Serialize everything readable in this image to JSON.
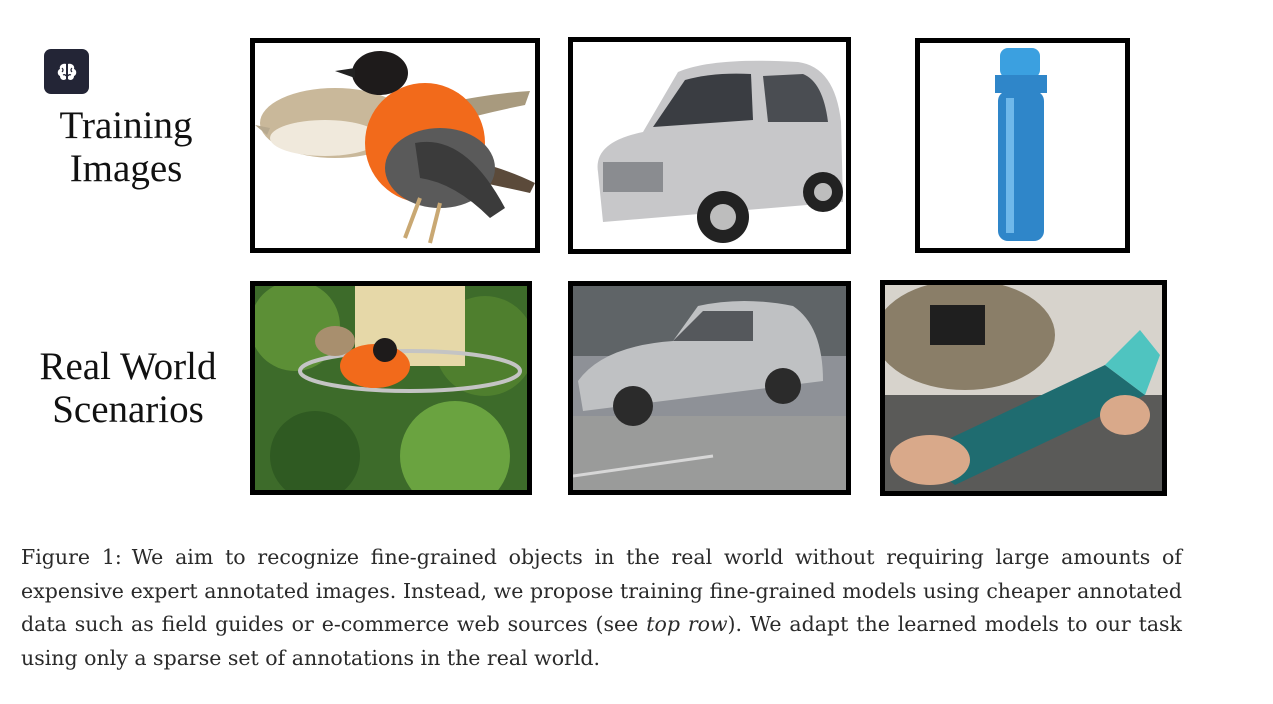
{
  "figure": {
    "row_labels": {
      "top": [
        "Training",
        "Images"
      ],
      "bottom": [
        "Real World",
        "Scenarios"
      ]
    },
    "panels": {
      "top": [
        "bird-illustration-panel",
        "car-studio-panel",
        "bottle-product-panel"
      ],
      "bottom": [
        "bird-feeder-photo-panel",
        "car-street-photo-panel",
        "bottle-hand-photo-panel"
      ]
    }
  },
  "caption": {
    "label": "Figure 1:",
    "text_before": "We aim to recognize fine-grained objects in the real world without requiring large amounts of expensive expert annotated images. Instead, we propose training fine-grained models using cheaper annotated data such as field guides or e-commerce web sources (see ",
    "emphasis": "top row",
    "text_after": "). We adapt the learned models to our task using only a sparse set of annotations in the real world."
  },
  "colors": {
    "icon_bg": "#232536",
    "bird_orange": "#f26a1b",
    "bottle_blue": "#2f86c9"
  },
  "icons": {
    "app": "brain-icon"
  }
}
